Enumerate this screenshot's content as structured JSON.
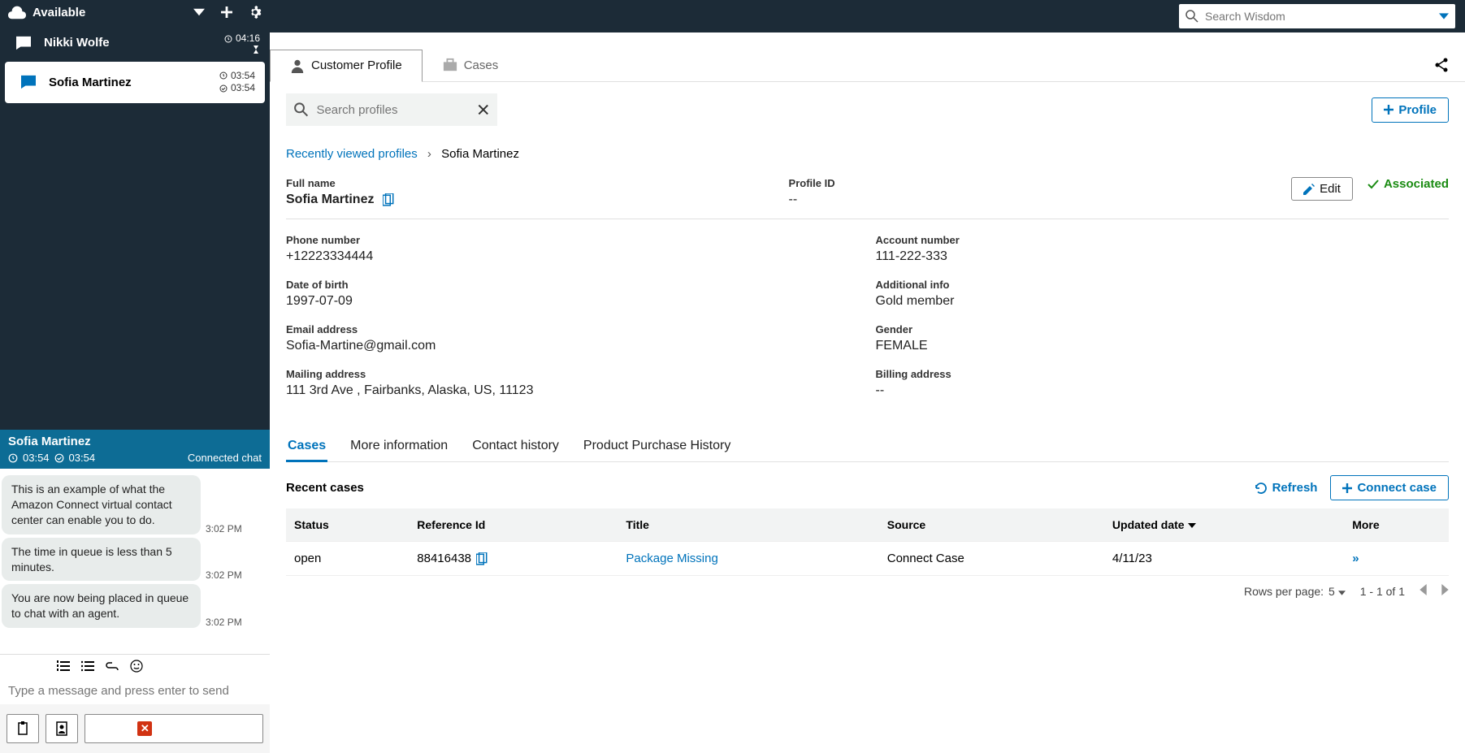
{
  "status": {
    "label": "Available"
  },
  "contacts": [
    {
      "name": "Nikki Wolfe",
      "t1": "04:16",
      "active": false
    },
    {
      "name": "Sofia Martinez",
      "t1": "03:54",
      "t2": "03:54",
      "active": true
    }
  ],
  "chat": {
    "name": "Sofia Martinez",
    "t1": "03:54",
    "t2": "03:54",
    "status": "Connected chat",
    "messages": [
      {
        "text": "This is an example of what the Amazon Connect virtual contact center can enable you to do.",
        "time": "3:02 PM"
      },
      {
        "text": "The time in queue is less than 5 minutes.",
        "time": "3:02 PM"
      },
      {
        "text": "You are now being placed in queue to chat with an agent.",
        "time": "3:02 PM"
      }
    ],
    "compose_placeholder": "Type a message and press enter to send",
    "end_label": "End chat"
  },
  "search_wisdom_placeholder": "Search Wisdom",
  "main_tabs": {
    "a": "Customer Profile",
    "b": "Cases"
  },
  "profile_search_placeholder": "Search profiles",
  "add_profile": "Profile",
  "breadcrumb": {
    "a": "Recently viewed profiles",
    "b": "Sofia Martinez"
  },
  "labels": {
    "full_name": "Full name",
    "profile_id": "Profile ID",
    "phone": "Phone number",
    "account": "Account number",
    "dob": "Date of birth",
    "addl": "Additional info",
    "email": "Email address",
    "gender": "Gender",
    "mailing": "Mailing address",
    "billing": "Billing address",
    "edit": "Edit",
    "associated": "Associated"
  },
  "profile": {
    "full_name": "Sofia Martinez",
    "profile_id": "--",
    "phone": "+12223334444",
    "account": "111-222-333",
    "dob": "1997-07-09",
    "addl": "Gold member",
    "email": "Sofia-Martine@gmail.com",
    "gender": "FEMALE",
    "mailing": "111 3rd Ave , Fairbanks, Alaska, US, 11123",
    "billing": "--"
  },
  "sub_tabs": {
    "a": "Cases",
    "b": "More information",
    "c": "Contact history",
    "d": "Product Purchase History"
  },
  "cases_section": {
    "recent": "Recent cases",
    "refresh": "Refresh",
    "connect": "Connect case",
    "cols": {
      "status": "Status",
      "ref": "Reference Id",
      "title": "Title",
      "source": "Source",
      "updated": "Updated date",
      "more": "More"
    },
    "rows": [
      {
        "status": "open",
        "ref": "88416438",
        "title": "Package Missing",
        "source": "Connect Case",
        "updated": "4/11/23"
      }
    ],
    "pagination": {
      "rpp_label": "Rows per page:",
      "rpp": "5",
      "range": "1 - 1 of 1"
    }
  }
}
